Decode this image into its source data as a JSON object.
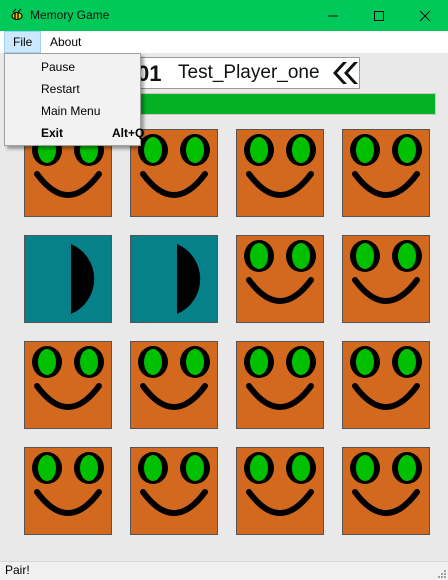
{
  "window": {
    "title": "Memory Game",
    "app_icon": "bee-icon"
  },
  "menubar": {
    "file": "File",
    "about": "About"
  },
  "file_menu": {
    "items": [
      "Pause",
      "Restart",
      "Main Menu"
    ],
    "exit": "Exit",
    "exit_shortcut": "Alt+Q"
  },
  "score": {
    "digits": "01",
    "player": "Test_Player_one",
    "button_icon": "rewind-icon"
  },
  "progress": {
    "fraction": 1.0,
    "color": "#06b025"
  },
  "colors": {
    "card_face": "#d2691e",
    "card_back": "#06818a",
    "eye_green": "#00c000"
  },
  "cards": [
    "face",
    "face",
    "face",
    "face",
    "back",
    "back",
    "face",
    "face",
    "face",
    "face",
    "face",
    "face",
    "face",
    "face",
    "face",
    "face"
  ],
  "status": {
    "text": "Pair!"
  }
}
